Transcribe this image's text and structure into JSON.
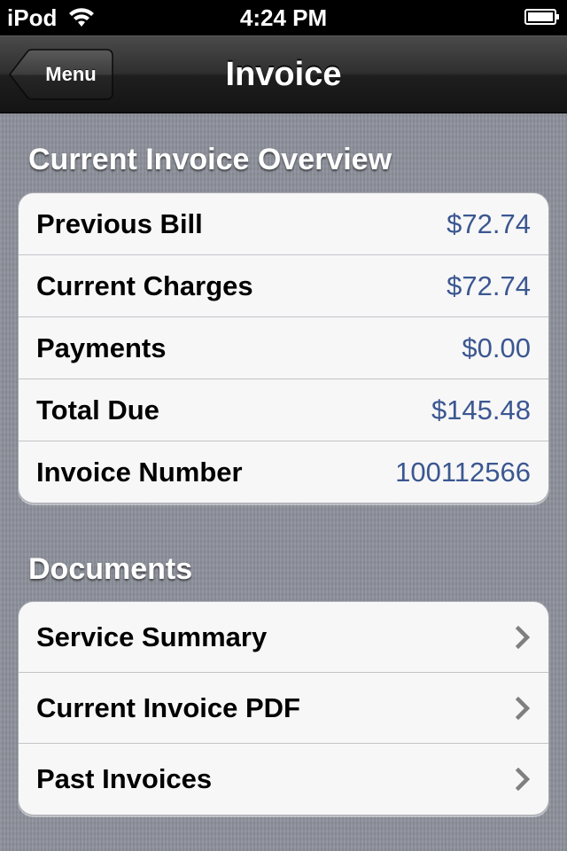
{
  "status_bar": {
    "carrier": "iPod",
    "time": "4:24 PM",
    "icons": [
      "wifi-icon",
      "battery-icon"
    ]
  },
  "nav_bar": {
    "back_label": "Menu",
    "title": "Invoice"
  },
  "overview": {
    "header": "Current Invoice Overview",
    "rows": [
      {
        "label": "Previous Bill",
        "value": "$72.74"
      },
      {
        "label": "Current Charges",
        "value": "$72.74"
      },
      {
        "label": "Payments",
        "value": "$0.00"
      },
      {
        "label": "Total Due",
        "value": "$145.48"
      },
      {
        "label": "Invoice Number",
        "value": "100112566"
      }
    ]
  },
  "documents": {
    "header": "Documents",
    "rows": [
      {
        "label": "Service Summary",
        "icon": "chevron-right-icon"
      },
      {
        "label": "Current Invoice PDF",
        "icon": "chevron-right-icon"
      },
      {
        "label": "Past Invoices",
        "icon": "chevron-right-icon"
      }
    ]
  },
  "colors": {
    "value_text": "#3b5791",
    "background": "#8d919b",
    "nav_bar": "#2f2f2f"
  }
}
